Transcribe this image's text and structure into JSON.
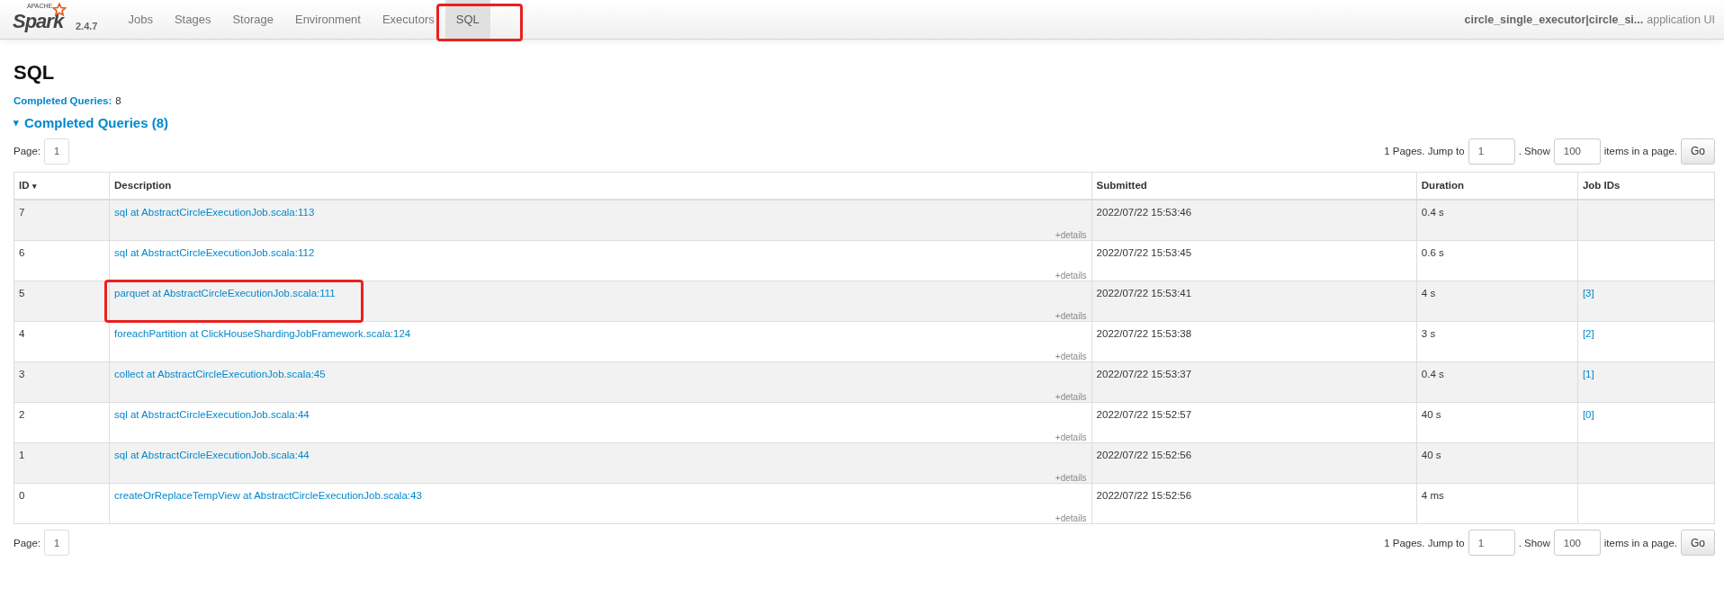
{
  "brand": {
    "prefix": "APACHE",
    "name": "Spark",
    "version": "2.4.7"
  },
  "tabs": [
    {
      "label": "Jobs",
      "selected": false,
      "highlighted": false
    },
    {
      "label": "Stages",
      "selected": false,
      "highlighted": false
    },
    {
      "label": "Storage",
      "selected": false,
      "highlighted": false
    },
    {
      "label": "Environment",
      "selected": false,
      "highlighted": false
    },
    {
      "label": "Executors",
      "selected": false,
      "highlighted": false
    },
    {
      "label": "SQL",
      "selected": true,
      "highlighted": true
    }
  ],
  "app_title": {
    "name": "circle_single_executor|circle_si...",
    "suffix": "application UI"
  },
  "heading": "SQL",
  "summary": {
    "label": "Completed Queries:",
    "value": "8"
  },
  "section": {
    "caret": "▾",
    "title": "Completed Queries (8)",
    "expanded": true
  },
  "pagination_top": {
    "page_label": "Page:",
    "current_page": "1",
    "pages_text": "1 Pages. Jump to",
    "jump_value": "1",
    "show_text": ". Show",
    "show_value": "100",
    "items_text": "items in a page.",
    "go": "Go"
  },
  "table": {
    "columns": [
      {
        "label": "ID",
        "sort": "▾"
      },
      {
        "label": "Description"
      },
      {
        "label": "Submitted"
      },
      {
        "label": "Duration"
      },
      {
        "label": "Job IDs"
      }
    ],
    "rows": [
      {
        "id": "7",
        "description": "sql at AbstractCircleExecutionJob.scala:113",
        "details": "+details",
        "submitted": "2022/07/22 15:53:46",
        "duration": "0.4 s",
        "job_ids": "",
        "highlighted": false
      },
      {
        "id": "6",
        "description": "sql at AbstractCircleExecutionJob.scala:112",
        "details": "+details",
        "submitted": "2022/07/22 15:53:45",
        "duration": "0.6 s",
        "job_ids": "",
        "highlighted": false
      },
      {
        "id": "5",
        "description": "parquet at AbstractCircleExecutionJob.scala:111",
        "details": "+details",
        "submitted": "2022/07/22 15:53:41",
        "duration": "4 s",
        "job_ids": "[3]",
        "highlighted": true
      },
      {
        "id": "4",
        "description": "foreachPartition at ClickHouseShardingJobFramework.scala:124",
        "details": "+details",
        "submitted": "2022/07/22 15:53:38",
        "duration": "3 s",
        "job_ids": "[2]",
        "highlighted": false
      },
      {
        "id": "3",
        "description": "collect at AbstractCircleExecutionJob.scala:45",
        "details": "+details",
        "submitted": "2022/07/22 15:53:37",
        "duration": "0.4 s",
        "job_ids": "[1]",
        "highlighted": false
      },
      {
        "id": "2",
        "description": "sql at AbstractCircleExecutionJob.scala:44",
        "details": "+details",
        "submitted": "2022/07/22 15:52:57",
        "duration": "40 s",
        "job_ids": "[0]",
        "highlighted": false
      },
      {
        "id": "1",
        "description": "sql at AbstractCircleExecutionJob.scala:44",
        "details": "+details",
        "submitted": "2022/07/22 15:52:56",
        "duration": "40 s",
        "job_ids": "",
        "highlighted": false
      },
      {
        "id": "0",
        "description": "createOrReplaceTempView at AbstractCircleExecutionJob.scala:43",
        "details": "+details",
        "submitted": "2022/07/22 15:52:56",
        "duration": "4 ms",
        "job_ids": "",
        "highlighted": false
      }
    ]
  },
  "pagination_bottom": {
    "page_label": "Page:",
    "current_page": "1",
    "pages_text": "1 Pages. Jump to",
    "jump_value": "1",
    "show_text": ". Show",
    "show_value": "100",
    "items_text": "items in a page.",
    "go": "Go"
  }
}
